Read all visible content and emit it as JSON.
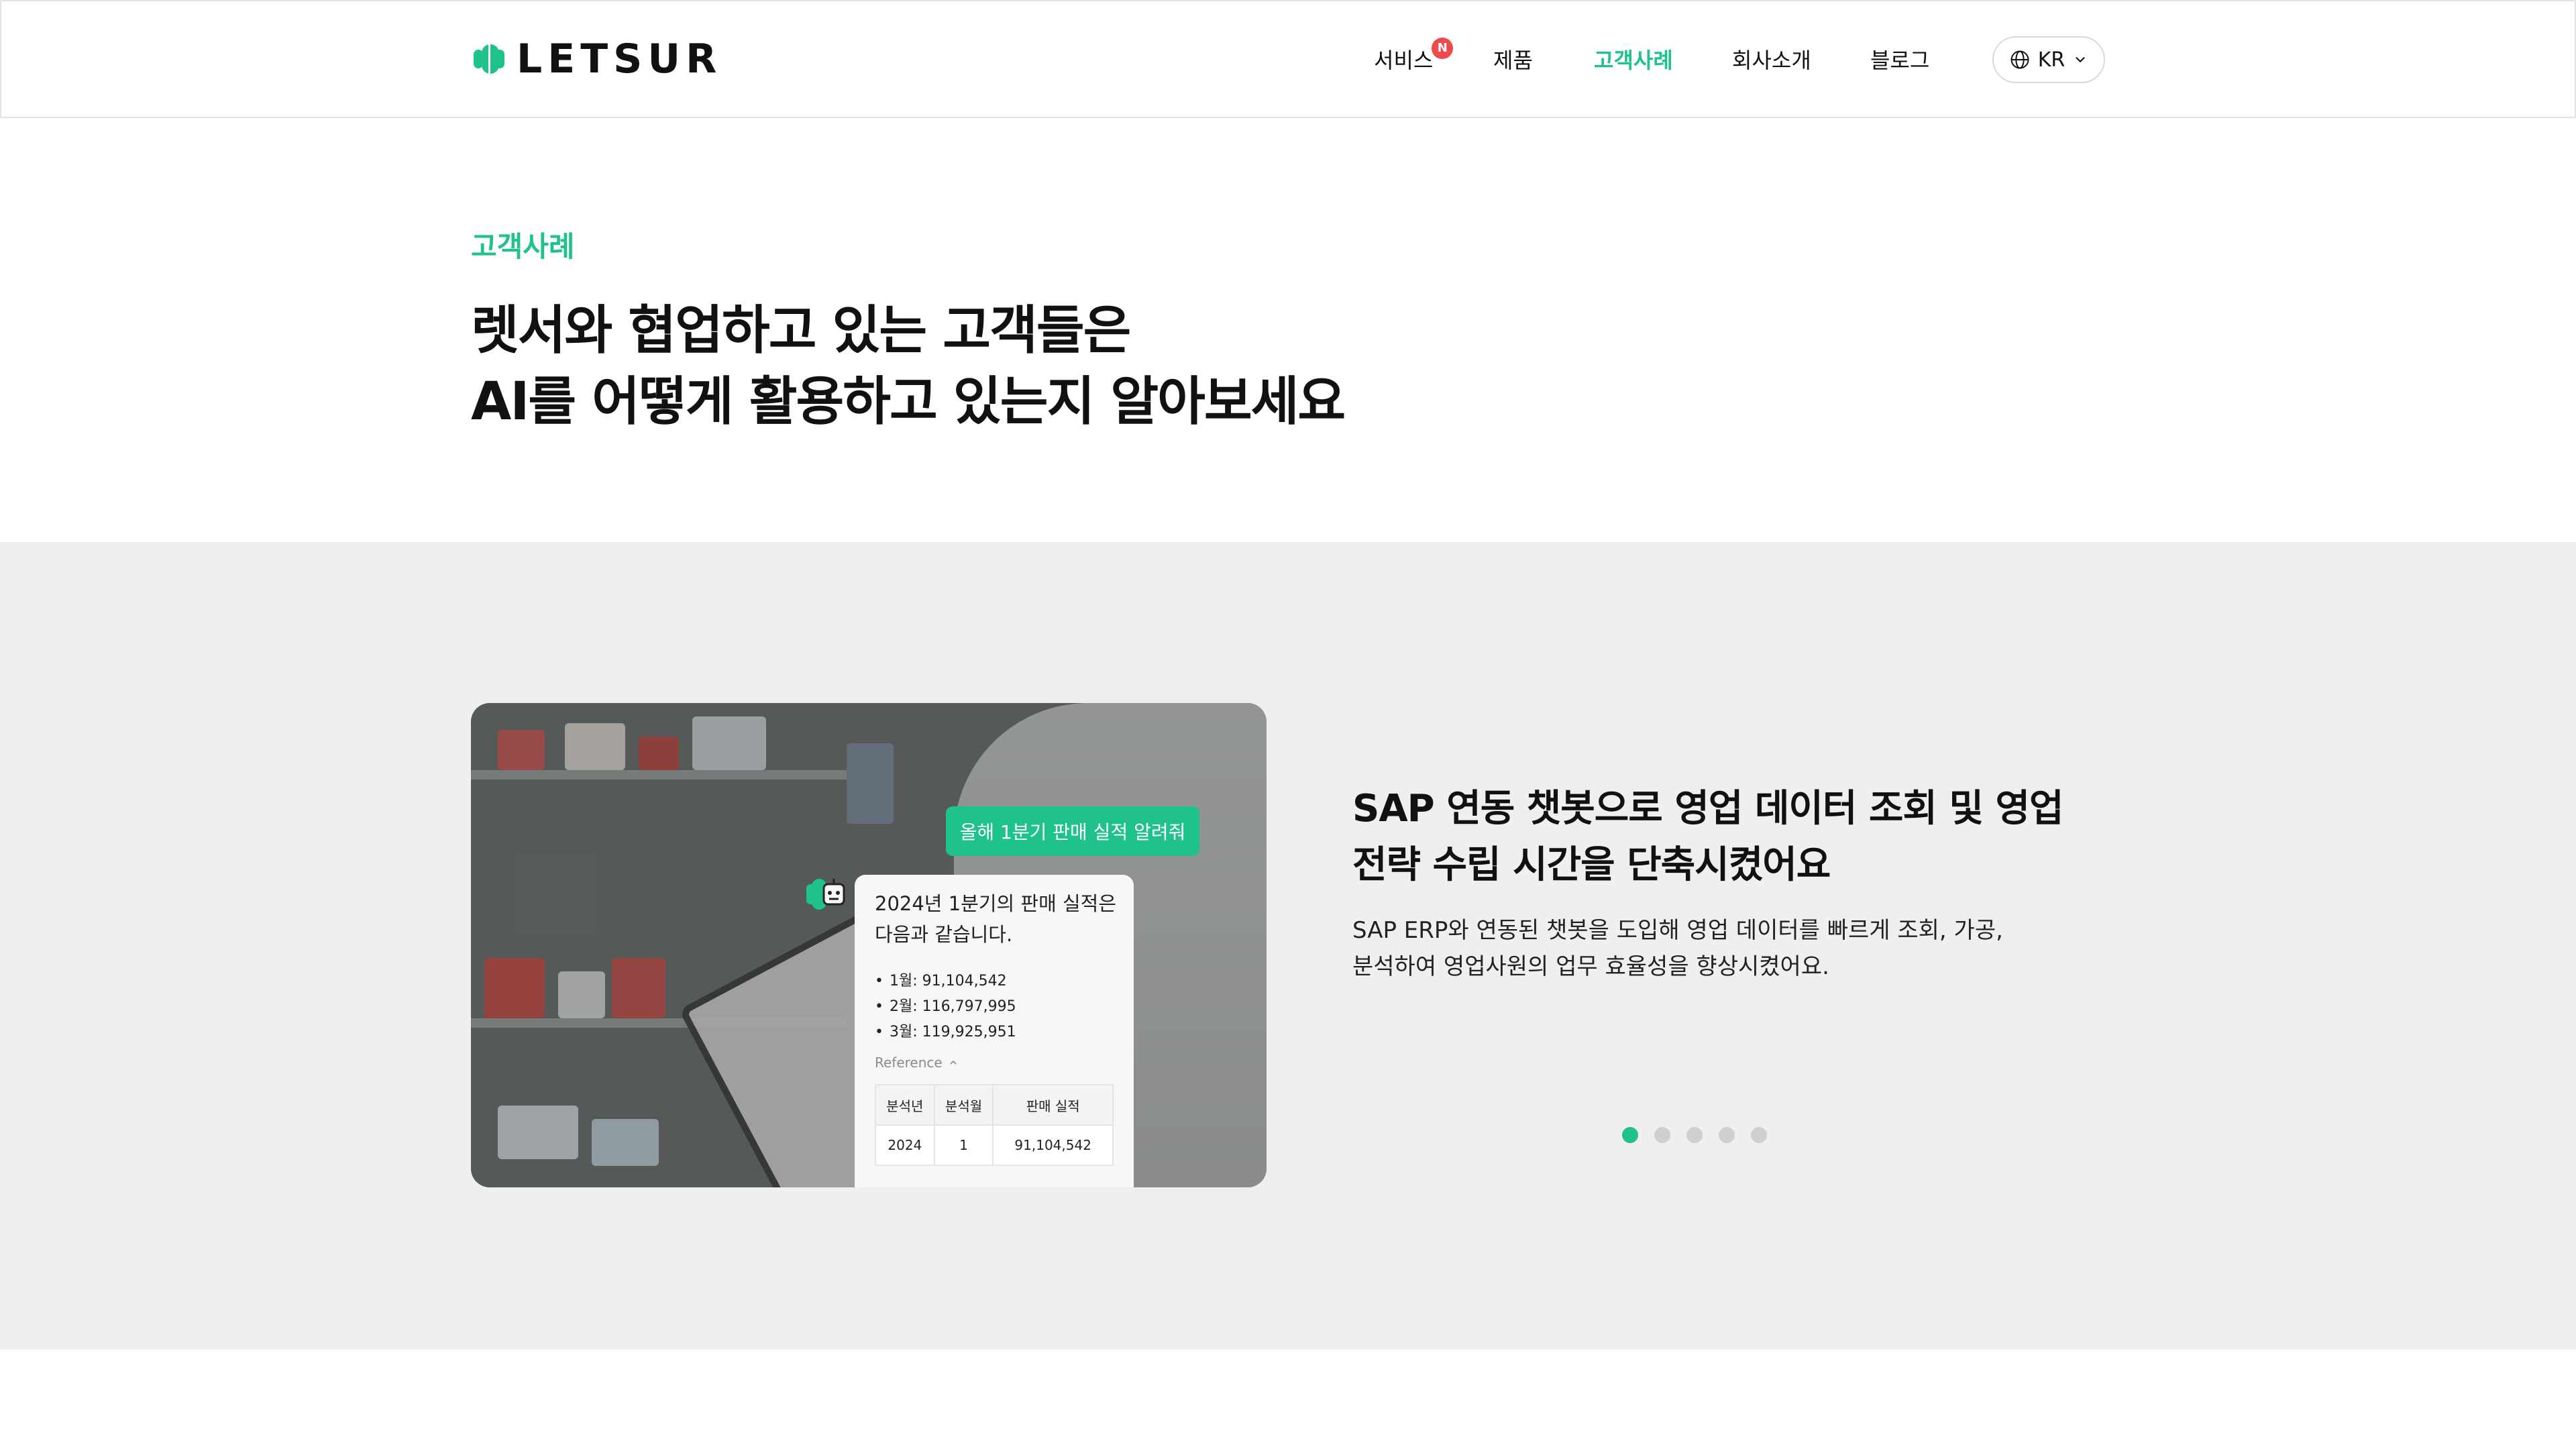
{
  "header": {
    "logo_text": "LETSUR",
    "nav": [
      {
        "label": "서비스",
        "badge": "N"
      },
      {
        "label": "제품"
      },
      {
        "label": "고객사례",
        "active": true
      },
      {
        "label": "회사소개"
      },
      {
        "label": "블로그"
      }
    ],
    "language": {
      "label": "KR",
      "icon": "globe-icon"
    }
  },
  "hero": {
    "eyebrow": "고객사례",
    "title_line1": "렛서와 협업하고 있는 고객들은",
    "title_line2": "AI를 어떻게 활용하고 있는지 알아보세요"
  },
  "case": {
    "chat": {
      "user_message": "올해 1분기 판매 실적 알려줘",
      "bot_line1": "2024년 1분기의 판매 실적은",
      "bot_line2": "다음과 같습니다.",
      "items": [
        "1월: 91,104,542",
        "2월: 116,797,995",
        "3월: 119,925,951"
      ],
      "reference_label": "Reference",
      "table": {
        "headers": [
          "분석년",
          "분석월",
          "판매 실적"
        ],
        "rows": [
          [
            "2024",
            "1",
            "91,104,542"
          ]
        ]
      }
    },
    "title_line1": "SAP 연동 챗봇으로 영업 데이터 조회 및 영업",
    "title_line2": "전략 수립 시간을 단축시켰어요",
    "desc_line1": "SAP ERP와 연동된 챗봇을 도입해 영업 데이터를 빠르게 조회, 가공,",
    "desc_line2": "분석하여 영업사원의 업무 효율성을 향상시켰어요.",
    "pagination": {
      "total": 5,
      "active_index": 0
    }
  },
  "colors": {
    "brand": "#1fc28a",
    "badge": "#f0494c",
    "section_bg": "#efefef"
  }
}
